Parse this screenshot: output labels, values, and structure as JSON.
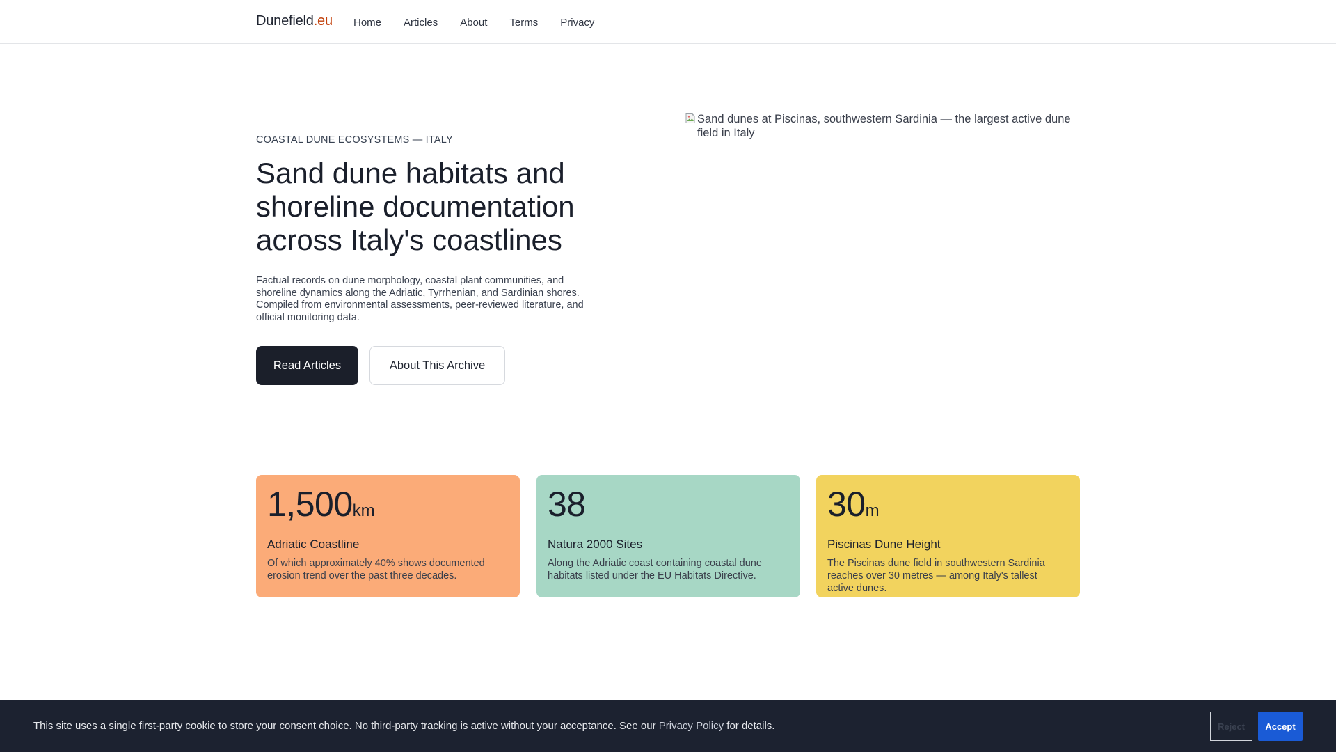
{
  "header": {
    "brand_name": "Dunefield",
    "brand_tld": ".eu",
    "nav": [
      "Home",
      "Articles",
      "About",
      "Terms",
      "Privacy"
    ]
  },
  "hero": {
    "eyebrow": "COASTAL DUNE ECOSYSTEMS — ITALY",
    "title": "Sand dune habitats and shoreline documentation across Italy's coastlines",
    "description": "Factual records on dune morphology, coastal plant communities, and shoreline dynamics along the Adriatic, Tyrrhenian, and Sardinian shores. Compiled from environmental assessments, peer-reviewed literature, and official monitoring data.",
    "primary_button": "Read Articles",
    "secondary_button": "About This Archive",
    "image_alt": "Sand dunes at Piscinas, southwestern Sardinia — the largest active dune field in Italy",
    "image_icon": "broken-image-icon"
  },
  "stats": [
    {
      "value": "1,500",
      "unit": "km",
      "title": "Adriatic Coastline",
      "description": "Of which approximately 40% shows documented erosion trend over the past three decades.",
      "color": "#fbab78"
    },
    {
      "value": "38",
      "unit": "",
      "title": "Natura 2000 Sites",
      "description": "Along the Adriatic coast containing coastal dune habitats listed under the EU Habitats Directive.",
      "color": "#a7d7c5"
    },
    {
      "value": "30",
      "unit": "m",
      "title": "Piscinas Dune Height",
      "description": "The Piscinas dune field in southwestern Sardinia reaches over 30 metres — among Italy's tallest active dunes.",
      "color": "#f2d35e"
    }
  ],
  "cookie": {
    "text_before": "This site uses a single first-party cookie to store your consent choice. No third-party tracking is active without your acceptance. See our ",
    "link_label": "Privacy Policy",
    "text_after": " for details.",
    "reject_label": "Reject",
    "accept_label": "Accept"
  },
  "colors": {
    "accent_tld": "#c2410c",
    "banner_bg": "#1c2230",
    "accept_bg": "#1a5bd6"
  }
}
